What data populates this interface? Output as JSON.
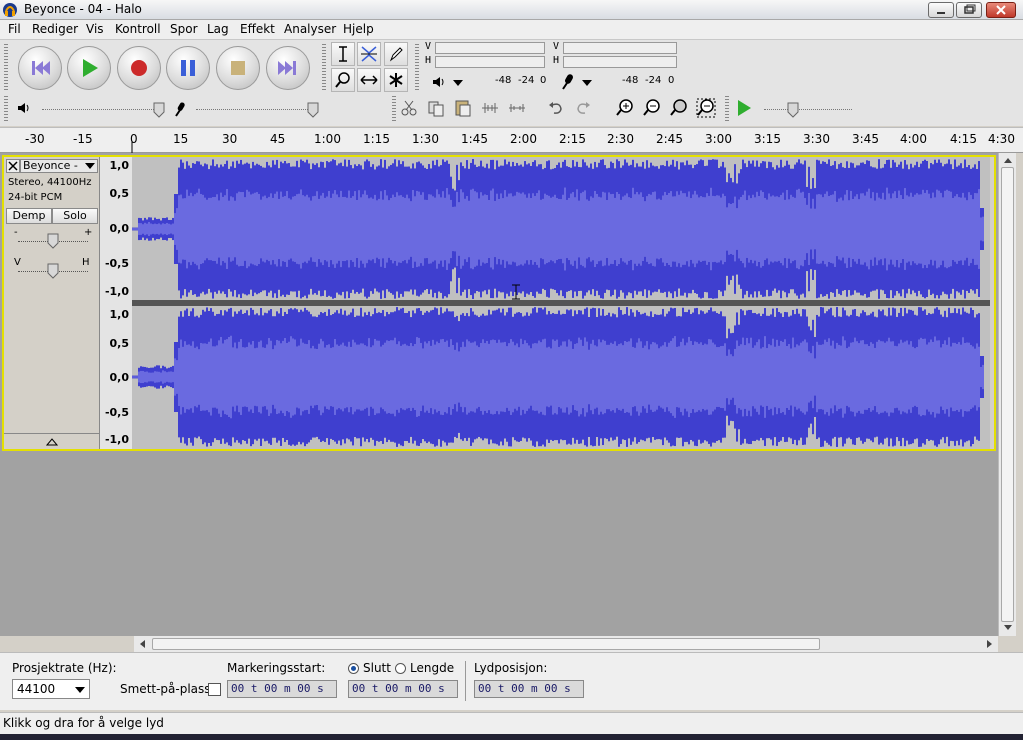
{
  "window": {
    "title": "Beyonce - 04 - Halo"
  },
  "menu": {
    "items": [
      "Fil",
      "Rediger",
      "Vis",
      "Kontroll",
      "Spor",
      "Lag",
      "Effekt",
      "Analyser",
      "Hjelp"
    ]
  },
  "meters": {
    "playback_v": "V",
    "playback_h": "H",
    "record_v": "V",
    "record_h": "H",
    "playback_scale": [
      "-48",
      "-24",
      "0"
    ],
    "record_scale": [
      "-48",
      "-24",
      "0"
    ]
  },
  "timeline": {
    "ticks": [
      "-30",
      "-15",
      "0",
      "15",
      "30",
      "45",
      "1:00",
      "1:15",
      "1:30",
      "1:45",
      "2:00",
      "2:15",
      "2:30",
      "2:45",
      "3:00",
      "3:15",
      "3:30",
      "3:45",
      "4:00",
      "4:15",
      "4:30"
    ]
  },
  "track": {
    "name": "Beyonce -",
    "format_line1": "Stereo, 44100Hz",
    "format_line2": "24-bit PCM",
    "mute_label": "Demp",
    "solo_label": "Solo",
    "gain_minus": "-",
    "gain_plus": "+",
    "pan_left": "V",
    "pan_right": "H",
    "vruler_ticks": [
      "1,0",
      "0,5",
      "0,0",
      "-0,5",
      "-1,0"
    ]
  },
  "selection_bar": {
    "project_rate_label": "Prosjektrate (Hz):",
    "project_rate_value": "44100",
    "snap_label": "Smett-på-plass",
    "selection_start_label": "Markeringsstart:",
    "end_label": "Slutt",
    "length_label": "Lengde",
    "audio_position_label": "Lydposisjon:",
    "time_start": "00 t 00 m 00 s",
    "time_end": "00 t 00 m 00 s",
    "time_position": "00 t 00 m 00 s"
  },
  "status": {
    "text": "Klikk og dra for å velge lyd"
  },
  "colors": {
    "wave": "#3f3fcf",
    "wave_rms": "#6a6ae0",
    "wave_bg": "#c0c0c0",
    "track_border": "#e4e000",
    "play_green": "#2fae2f",
    "record_red": "#cc2a2a",
    "pause_blue": "#3a5fd8",
    "stop_tan": "#c9b27a",
    "skip_purple": "#8a7ad6"
  }
}
